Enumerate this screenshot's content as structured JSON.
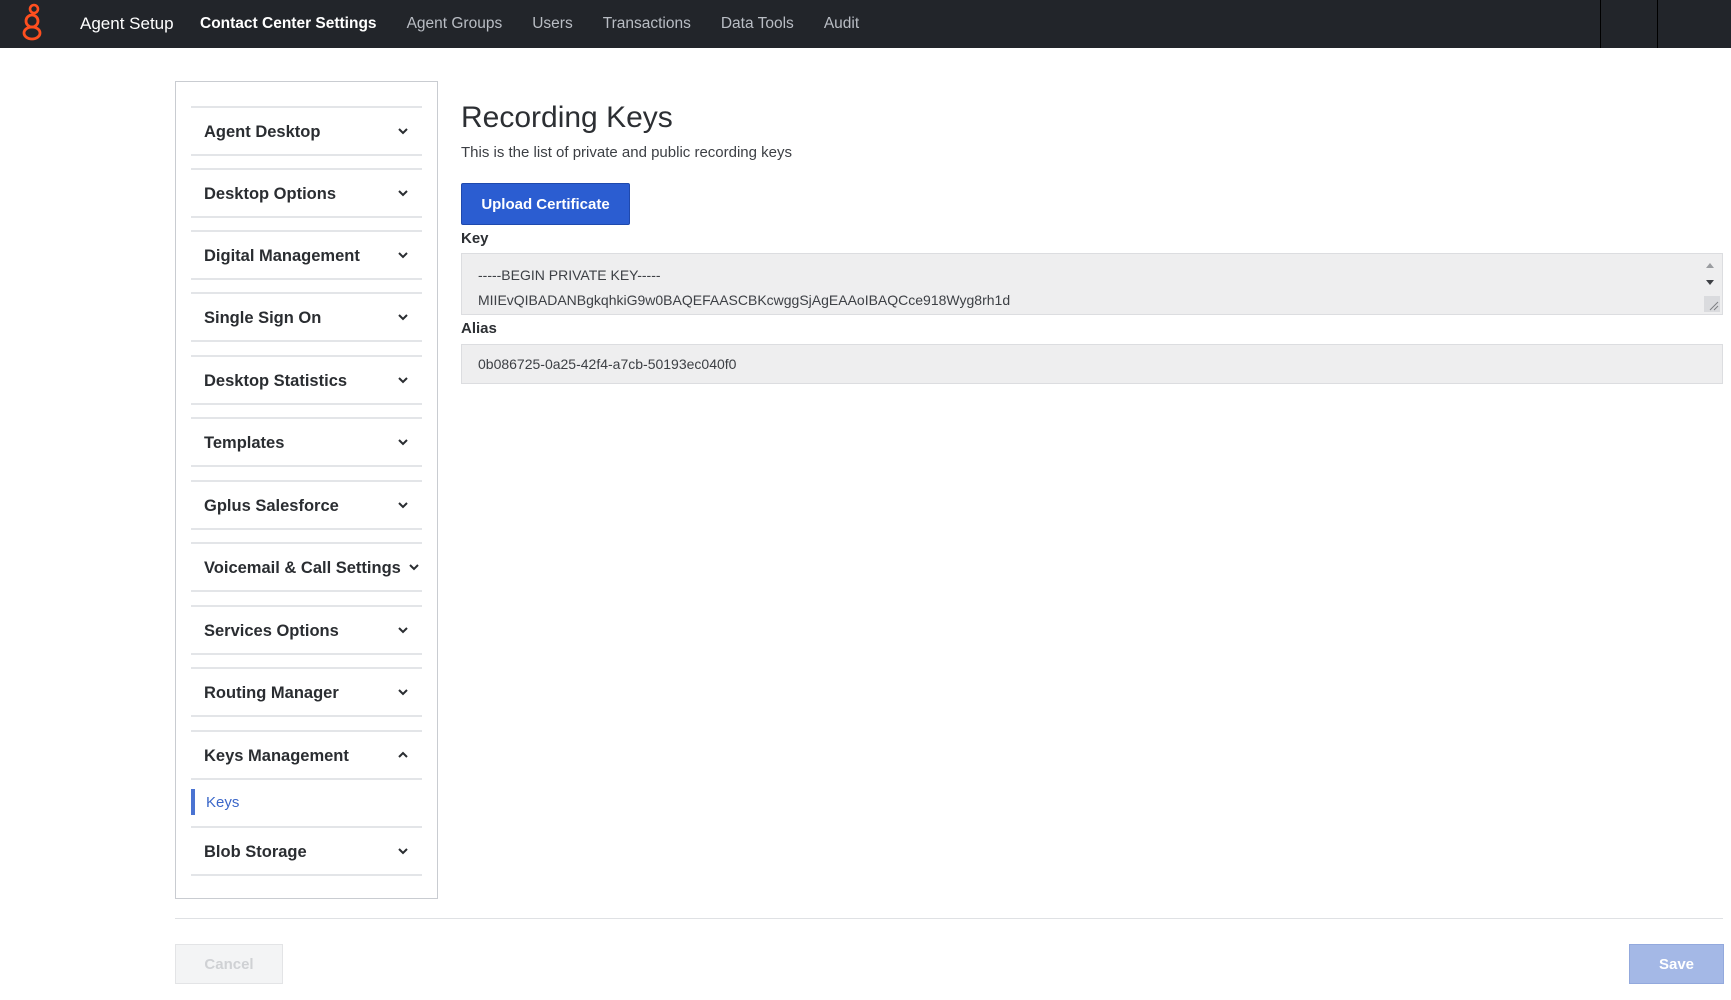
{
  "header": {
    "app_title": "Agent Setup",
    "nav": [
      {
        "label": "Contact Center Settings",
        "active": true
      },
      {
        "label": "Agent Groups",
        "active": false
      },
      {
        "label": "Users",
        "active": false
      },
      {
        "label": "Transactions",
        "active": false
      },
      {
        "label": "Data Tools",
        "active": false
      },
      {
        "label": "Audit",
        "active": false
      }
    ],
    "logo_icon": "genesys-logo-icon",
    "logo_color": "#ff4f1f"
  },
  "sidebar": {
    "items": [
      {
        "label": "Agent Desktop",
        "expanded": false
      },
      {
        "label": "Desktop Options",
        "expanded": false
      },
      {
        "label": "Digital Management",
        "expanded": false
      },
      {
        "label": "Single Sign On",
        "expanded": false
      },
      {
        "label": "Desktop Statistics",
        "expanded": false
      },
      {
        "label": "Templates",
        "expanded": false
      },
      {
        "label": "Gplus Salesforce",
        "expanded": false
      },
      {
        "label": "Voicemail & Call Settings",
        "expanded": false
      },
      {
        "label": "Services Options",
        "expanded": false
      },
      {
        "label": "Routing Manager",
        "expanded": false
      },
      {
        "label": "Keys Management",
        "expanded": true
      },
      {
        "label": "Blob Storage",
        "expanded": false
      }
    ],
    "active_subitem": "Keys",
    "accent_color": "#4a73d2"
  },
  "main": {
    "title": "Recording Keys",
    "subtitle": "This is the list of private and public recording keys",
    "upload_button": "Upload Certificate",
    "key_label": "Key",
    "key_line1": "-----BEGIN PRIVATE KEY-----",
    "key_line2": "MIIEvQIBADANBgkqhkiG9w0BAQEFAASCBKcwggSjAgEAAoIBAQCce918Wyg8rh1d",
    "alias_label": "Alias",
    "alias_value": "0b086725-0a25-42f4-a7cb-50193ec040f0"
  },
  "footer": {
    "cancel_label": "Cancel",
    "save_label": "Save"
  }
}
